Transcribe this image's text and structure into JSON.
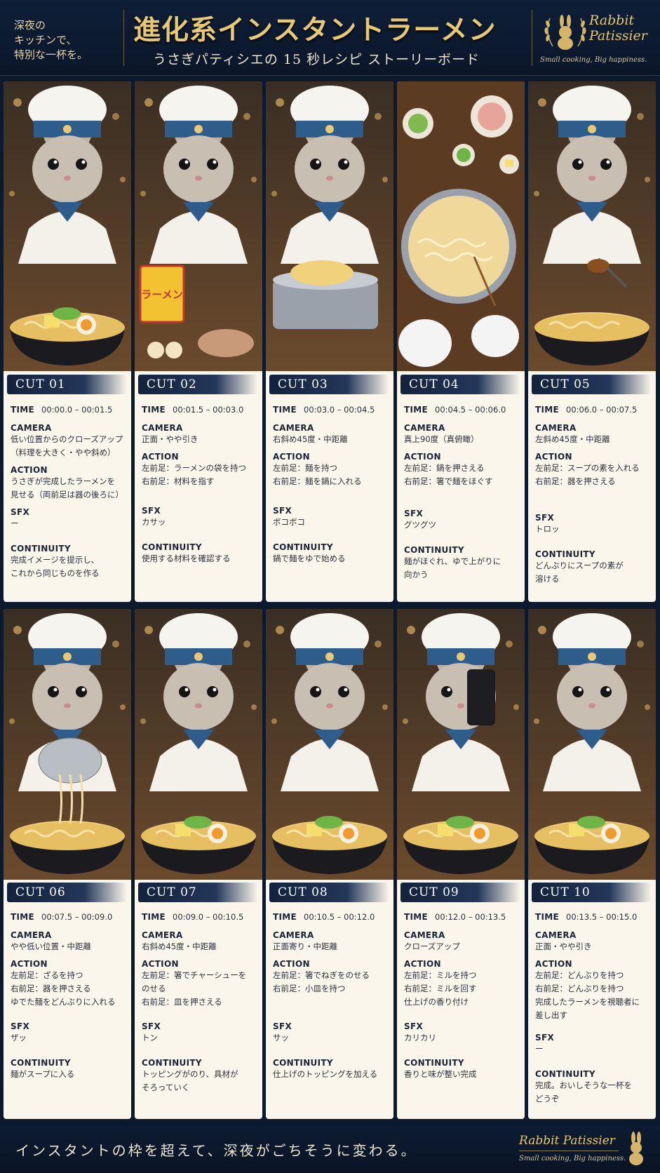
{
  "header": {
    "tagline": "深夜の\nキッチンで、\n特別な一杯を。",
    "title": "進化系インスタントラーメン",
    "subtitle": "うさぎパティシエの 15 秒レシピ ストーリーボード",
    "brand_name": "Rabbit Patissier",
    "brand_slogan": "Small cooking, Big happiness."
  },
  "labels": {
    "time": "TIME",
    "camera": "CAMERA",
    "action": "ACTION",
    "sfx": "SFX",
    "continuity": "CONTINUITY"
  },
  "cuts": [
    {
      "cut": "CUT 01",
      "time": "00:00.0 – 00:01.5",
      "camera": "低い位置からのクローズアップ\n（料理を大きく・やや斜め）",
      "action": "うさぎが完成したラーメンを\n見せる（両前足は器の後ろに）",
      "sfx": "ー",
      "continuity": "完成イメージを提示し、\nこれから同じものを作る"
    },
    {
      "cut": "CUT 02",
      "time": "00:01.5 – 00:03.0",
      "camera": "正面・やや引き",
      "action": "左前足：ラーメンの袋を持つ\n右前足：材料を指す",
      "sfx": "カサッ",
      "continuity": "使用する材料を確認する"
    },
    {
      "cut": "CUT 03",
      "time": "00:03.0 – 00:04.5",
      "camera": "右斜め45度・中距離",
      "action": "左前足：麺を持つ\n右前足：麺を鍋に入れる",
      "sfx": "ボコボコ",
      "continuity": "鍋で麺をゆで始める"
    },
    {
      "cut": "CUT 04",
      "time": "00:04.5 – 00:06.0",
      "camera": "真上90度（真俯瞰）",
      "action": "左前足：鍋を押さえる\n右前足：箸で麺をほぐす",
      "sfx": "グツグツ",
      "continuity": "麺がほぐれ、ゆで上がりに\n向かう"
    },
    {
      "cut": "CUT 05",
      "time": "00:06.0 – 00:07.5",
      "camera": "左斜め45度・中距離",
      "action": "左前足：スープの素を入れる\n右前足：器を押さえる",
      "sfx": "トロッ",
      "continuity": "どんぶりにスープの素が\n溶ける"
    },
    {
      "cut": "CUT 06",
      "time": "00:07.5 – 00:09.0",
      "camera": "やや低い位置・中距離",
      "action": "左前足：ざるを持つ\n右前足：器を押さえる\nゆでた麺をどんぶりに入れる",
      "sfx": "ザッ",
      "continuity": "麺がスープに入る"
    },
    {
      "cut": "CUT 07",
      "time": "00:09.0 – 00:10.5",
      "camera": "右斜め45度・中距離",
      "action": "左前足：箸でチャーシューを\nのせる\n右前足：皿を押さえる",
      "sfx": "トン",
      "continuity": "トッピングがのり、具材が\nそろっていく"
    },
    {
      "cut": "CUT 08",
      "time": "00:10.5 – 00:12.0",
      "camera": "正面寄り・中距離",
      "action": "左前足：箸でねぎをのせる\n右前足：小皿を持つ",
      "sfx": "サッ",
      "continuity": "仕上げのトッピングを加える"
    },
    {
      "cut": "CUT 09",
      "time": "00:12.0 – 00:13.5",
      "camera": "クローズアップ",
      "action": "左前足：ミルを持つ\n右前足：ミルを回す\n仕上げの香り付け",
      "sfx": "カリカリ",
      "continuity": "香りと味が整い完成"
    },
    {
      "cut": "CUT 10",
      "time": "00:13.5 – 00:15.0",
      "camera": "正面・やや引き",
      "action": "左前足：どんぶりを持つ\n右前足：どんぶりを持つ\n完成したラーメンを視聴者に\n差し出す",
      "sfx": "ー",
      "continuity": "完成。おいしそうな一杯を\nどうぞ"
    }
  ],
  "package_text": "ラーメン",
  "footer": {
    "text": "インスタントの枠を超えて、深夜がごちそうに変わる。",
    "brand_name": "Rabbit Patissier",
    "brand_slogan": "Small cooking, Big happiness."
  },
  "colors": {
    "navy": "#0d1a2e",
    "gold": "#e7c877",
    "card": "#faf6ec"
  }
}
